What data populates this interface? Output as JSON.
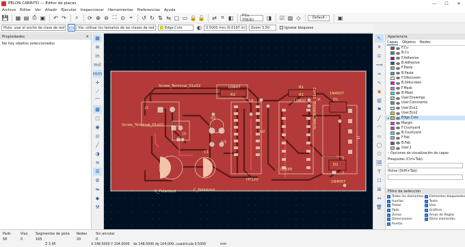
{
  "window": {
    "title": "PELON CARRITO — Editor de placas"
  },
  "menu": [
    "Archivo",
    "Editar",
    "Ver",
    "Añadir",
    "Ejecutar",
    "Inspeccionar",
    "Herramientas",
    "Preferencias",
    "Ayuda"
  ],
  "toolbar": {
    "layer": "F.Cu (PgUp)",
    "preset": "‹ Default ›"
  },
  "options": {
    "track": "Pista: usar el ancho de clase de red",
    "via": "Vía: utilizar los tamaños de las clases de red",
    "edge": "Edge.Cuts",
    "grid": "0.5000 mm (0.0197 in)",
    "zoom": "Zoom 3.50",
    "ignore": "Ignorar bloqueos"
  },
  "properties": {
    "title": "Propiedades",
    "empty": "No hay objetos seleccionados"
  },
  "appearance": {
    "title": "Apariencia",
    "tabs": [
      "Capas",
      "Objetos",
      "Redes"
    ],
    "layers": [
      {
        "name": "F.Cu",
        "color": "#c83434"
      },
      {
        "name": "B.Cu",
        "color": "#4d7fc4"
      },
      {
        "name": "F.Adhesive",
        "color": "#a3009b"
      },
      {
        "name": "B.Adhesive",
        "color": "#0058a8"
      },
      {
        "name": "F.Paste",
        "color": "#b4a09e"
      },
      {
        "name": "B.Paste",
        "color": "#00c2c2"
      },
      {
        "name": "F.Silkscreen",
        "color": "#f2eda1"
      },
      {
        "name": "B.Silkscreen",
        "color": "#e800e8"
      },
      {
        "name": "F.Mask",
        "color": "#d864ff"
      },
      {
        "name": "B.Mask",
        "color": "#02ffee"
      },
      {
        "name": "User.Drawings",
        "color": "#c2c2c2"
      },
      {
        "name": "User.Comments",
        "color": "#5994dc"
      },
      {
        "name": "User.Eco1",
        "color": "#b4dbd2"
      },
      {
        "name": "User.Eco2",
        "color": "#d8c852"
      },
      {
        "name": "Edge.Cuts",
        "color": "#d0d200"
      },
      {
        "name": "Margin",
        "color": "#ff26e2"
      },
      {
        "name": "F.Courtyard",
        "color": "#ff26e2"
      },
      {
        "name": "B.Courtyard",
        "color": "#26e9ff"
      },
      {
        "name": "F.Fab",
        "color": "#afafaf"
      },
      {
        "name": "B.Fab",
        "color": "#5858b4"
      },
      {
        "name": "User.1",
        "color": "#c2c2c2"
      }
    ],
    "layer_options": "Opciones de visualización de capas",
    "presets_label": "Preajustes (Ctrl+Tab):",
    "views_label": "Vistas (Shift+Tab):"
  },
  "filter": {
    "title": "Filtro de selección",
    "items": [
      "Todos los elementos",
      "Elementos bloqueados",
      "Huellas",
      "Texto",
      "Pistas",
      "Vías",
      "Pads",
      "Gráficos",
      "Zonas",
      "Áreas de Reglas",
      "Dimensiones",
      "Otros elementos",
      "Puntos"
    ]
  },
  "status": {
    "pads_label": "Pads",
    "pads": "58",
    "vias_label": "Vías",
    "vias": "0",
    "segments_label": "Segmentos de pista",
    "segments": "165",
    "nets_label": "Redes",
    "nets": "20",
    "unrouted_label": "Sin enrutar",
    "unrouted": "0",
    "z": "Z 3.45",
    "xy": "X 148.5000  Y 104.0000",
    "dxy": "dx 148.5000  dy 104.000...",
    "grid": "cuadrícula 0.5000",
    "units": "mm"
  },
  "board_labels": {
    "term1": "Screw_Terminal_01x02",
    "term2": "Screw_Terminal_01x02",
    "j2": "J2",
    "j3": "J3",
    "r2": "R2",
    "ld807": "LD807",
    "r1": "R1",
    "r1b": "R1",
    "d1": "D1",
    "d2": "D2",
    "k": "K",
    "ln4007a": "1N4007",
    "ln4007b": "1N4007",
    "j1": "J1",
    "q1": "Q1",
    "c1": "C1",
    "cpol1": "C_Polarized",
    "cpol2": "C_Polarized",
    "l293": "L293D",
    "u1": "U1",
    "u2": "U2",
    "u1b": "U1",
    "ld807b": "LD807",
    "ht": "HT120",
    "term3": "Screw_Terminal_01x02"
  }
}
